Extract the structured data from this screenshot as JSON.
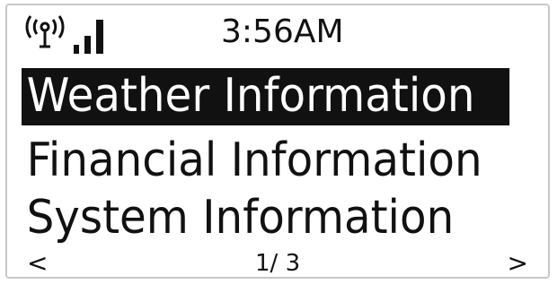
{
  "status": {
    "time": "3:56AM",
    "icons": [
      "wireless-antenna-icon",
      "signal-strength-icon"
    ]
  },
  "menu": {
    "items": [
      {
        "label": "Weather Information",
        "selected": true
      },
      {
        "label": "Financial Information",
        "selected": false
      },
      {
        "label": "System Information",
        "selected": false
      }
    ]
  },
  "footer": {
    "prev": "<",
    "page": "1/ 3",
    "next": ">"
  },
  "colors": {
    "background": "#ffffff",
    "foreground": "#111111",
    "highlight": "#111111",
    "highlight_text": "#ffffff"
  }
}
